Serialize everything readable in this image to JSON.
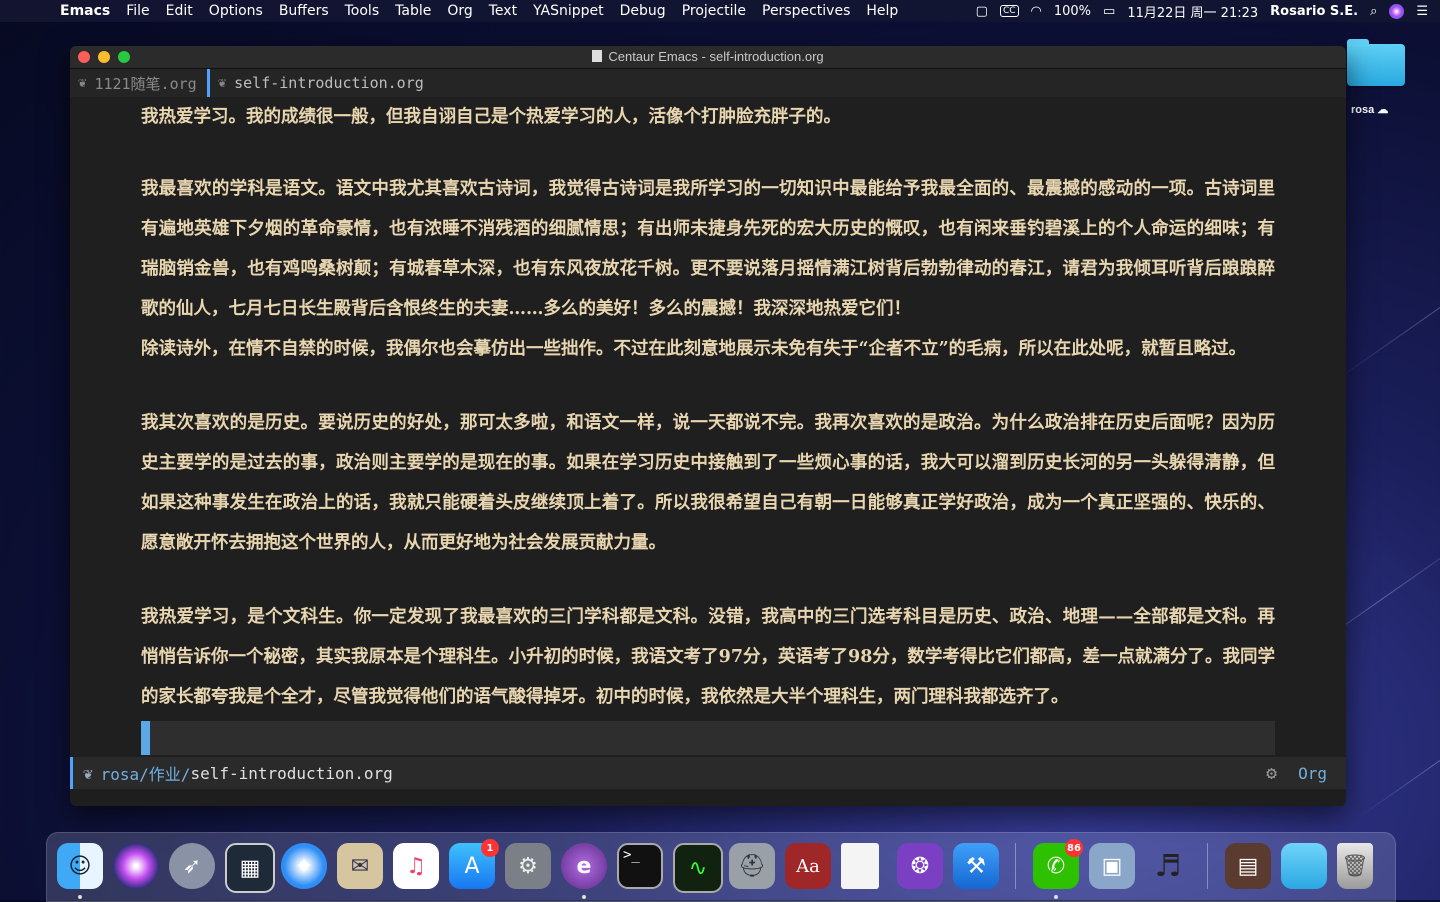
{
  "menubar": {
    "items": [
      "Emacs",
      "File",
      "Edit",
      "Options",
      "Buffers",
      "Tools",
      "Table",
      "Org",
      "Text",
      "YASnippet",
      "Debug",
      "Projectile",
      "Perspectives",
      "Help"
    ],
    "battery": "100%",
    "datetime": "11月22日 周一 21:23",
    "user": "Rosario S.E."
  },
  "desktop": {
    "folder_label": "rosa"
  },
  "window": {
    "title": "Centaur Emacs - self-introduction.org",
    "tabs": [
      "1121随笔.org",
      "self-introduction.org"
    ]
  },
  "editor": {
    "paragraphs": [
      "我热爱学习。我的成绩很一般，但我自诩自己是个热爱学习的人，活像个打肿脸充胖子的。",
      "我最喜欢的学科是语文。语文中我尤其喜欢古诗词，我觉得古诗词是我所学习的一切知识中最能给予我最全面的、最震撼的感动的一项。古诗词里有遍地英雄下夕烟的革命豪情，也有浓睡不消残酒的细腻情思；有出师未捷身先死的宏大历史的慨叹，也有闲来垂钓碧溪上的个人命运的细味；有瑞脑销金兽，也有鸡鸣桑树颠；有城春草木深，也有东风夜放花千树。更不要说落月摇情满江树背后勃勃律动的春江，请君为我倾耳听背后踉踉醉歌的仙人，七月七日长生殿背后含恨终生的夫妻……多么的美好！多么的震撼！我深深地热爱它们！",
      "除读诗外，在情不自禁的时候，我偶尔也会摹仿出一些拙作。不过在此刻意地展示未免有失于“企者不立”的毛病，所以在此处呢，就暂且略过。",
      "我其次喜欢的是历史。要说历史的好处，那可太多啦，和语文一样，说一天都说不完。我再次喜欢的是政治。为什么政治排在历史后面呢？因为历史主要学的是过去的事，政治则主要学的是现在的事。如果在学习历史中接触到了一些烦心事的话，我大可以溜到历史长河的另一头躲得清静，但如果这种事发生在政治上的话，我就只能硬着头皮继续顶上着了。所以我很希望自己有朝一日能够真正学好政治，成为一个真正坚强的、快乐的、愿意敞开怀去拥抱这个世界的人，从而更好地为社会发展贡献力量。",
      "我热爱学习，是个文科生。你一定发现了我最喜欢的三门学科都是文科。没错，我高中的三门选考科目是历史、政治、地理——全部都是文科。再悄悄告诉你一个秘密，其实我原本是个理科生。小升初的时候，我语文考了97分，英语考了98分，数学考得比它们都高，差一点就满分了。我同学的家长都夸我是个全才，尽管我觉得他们的语气酸得掉牙。初中的时候，我依然是大半个理科生，两门理科我都选齐了。"
    ]
  },
  "modeline": {
    "dir": "rosa/作业/",
    "file": "self-introduction.org",
    "mode": "Org"
  },
  "dock": {
    "apps": [
      "finder",
      "siri",
      "launchpad",
      "activity-monitor-dashboard",
      "safari",
      "preview",
      "music",
      "app-store",
      "system-preferences",
      "emacs",
      "terminal",
      "activity-monitor",
      "disk-utility",
      "dictionary",
      "textedit",
      "github-desktop",
      "xcode",
      "wechat",
      "image-capture",
      "garageband",
      "books",
      "downloads-folder",
      "trash"
    ],
    "badges": {
      "app-store": "1",
      "wechat": "86"
    }
  }
}
